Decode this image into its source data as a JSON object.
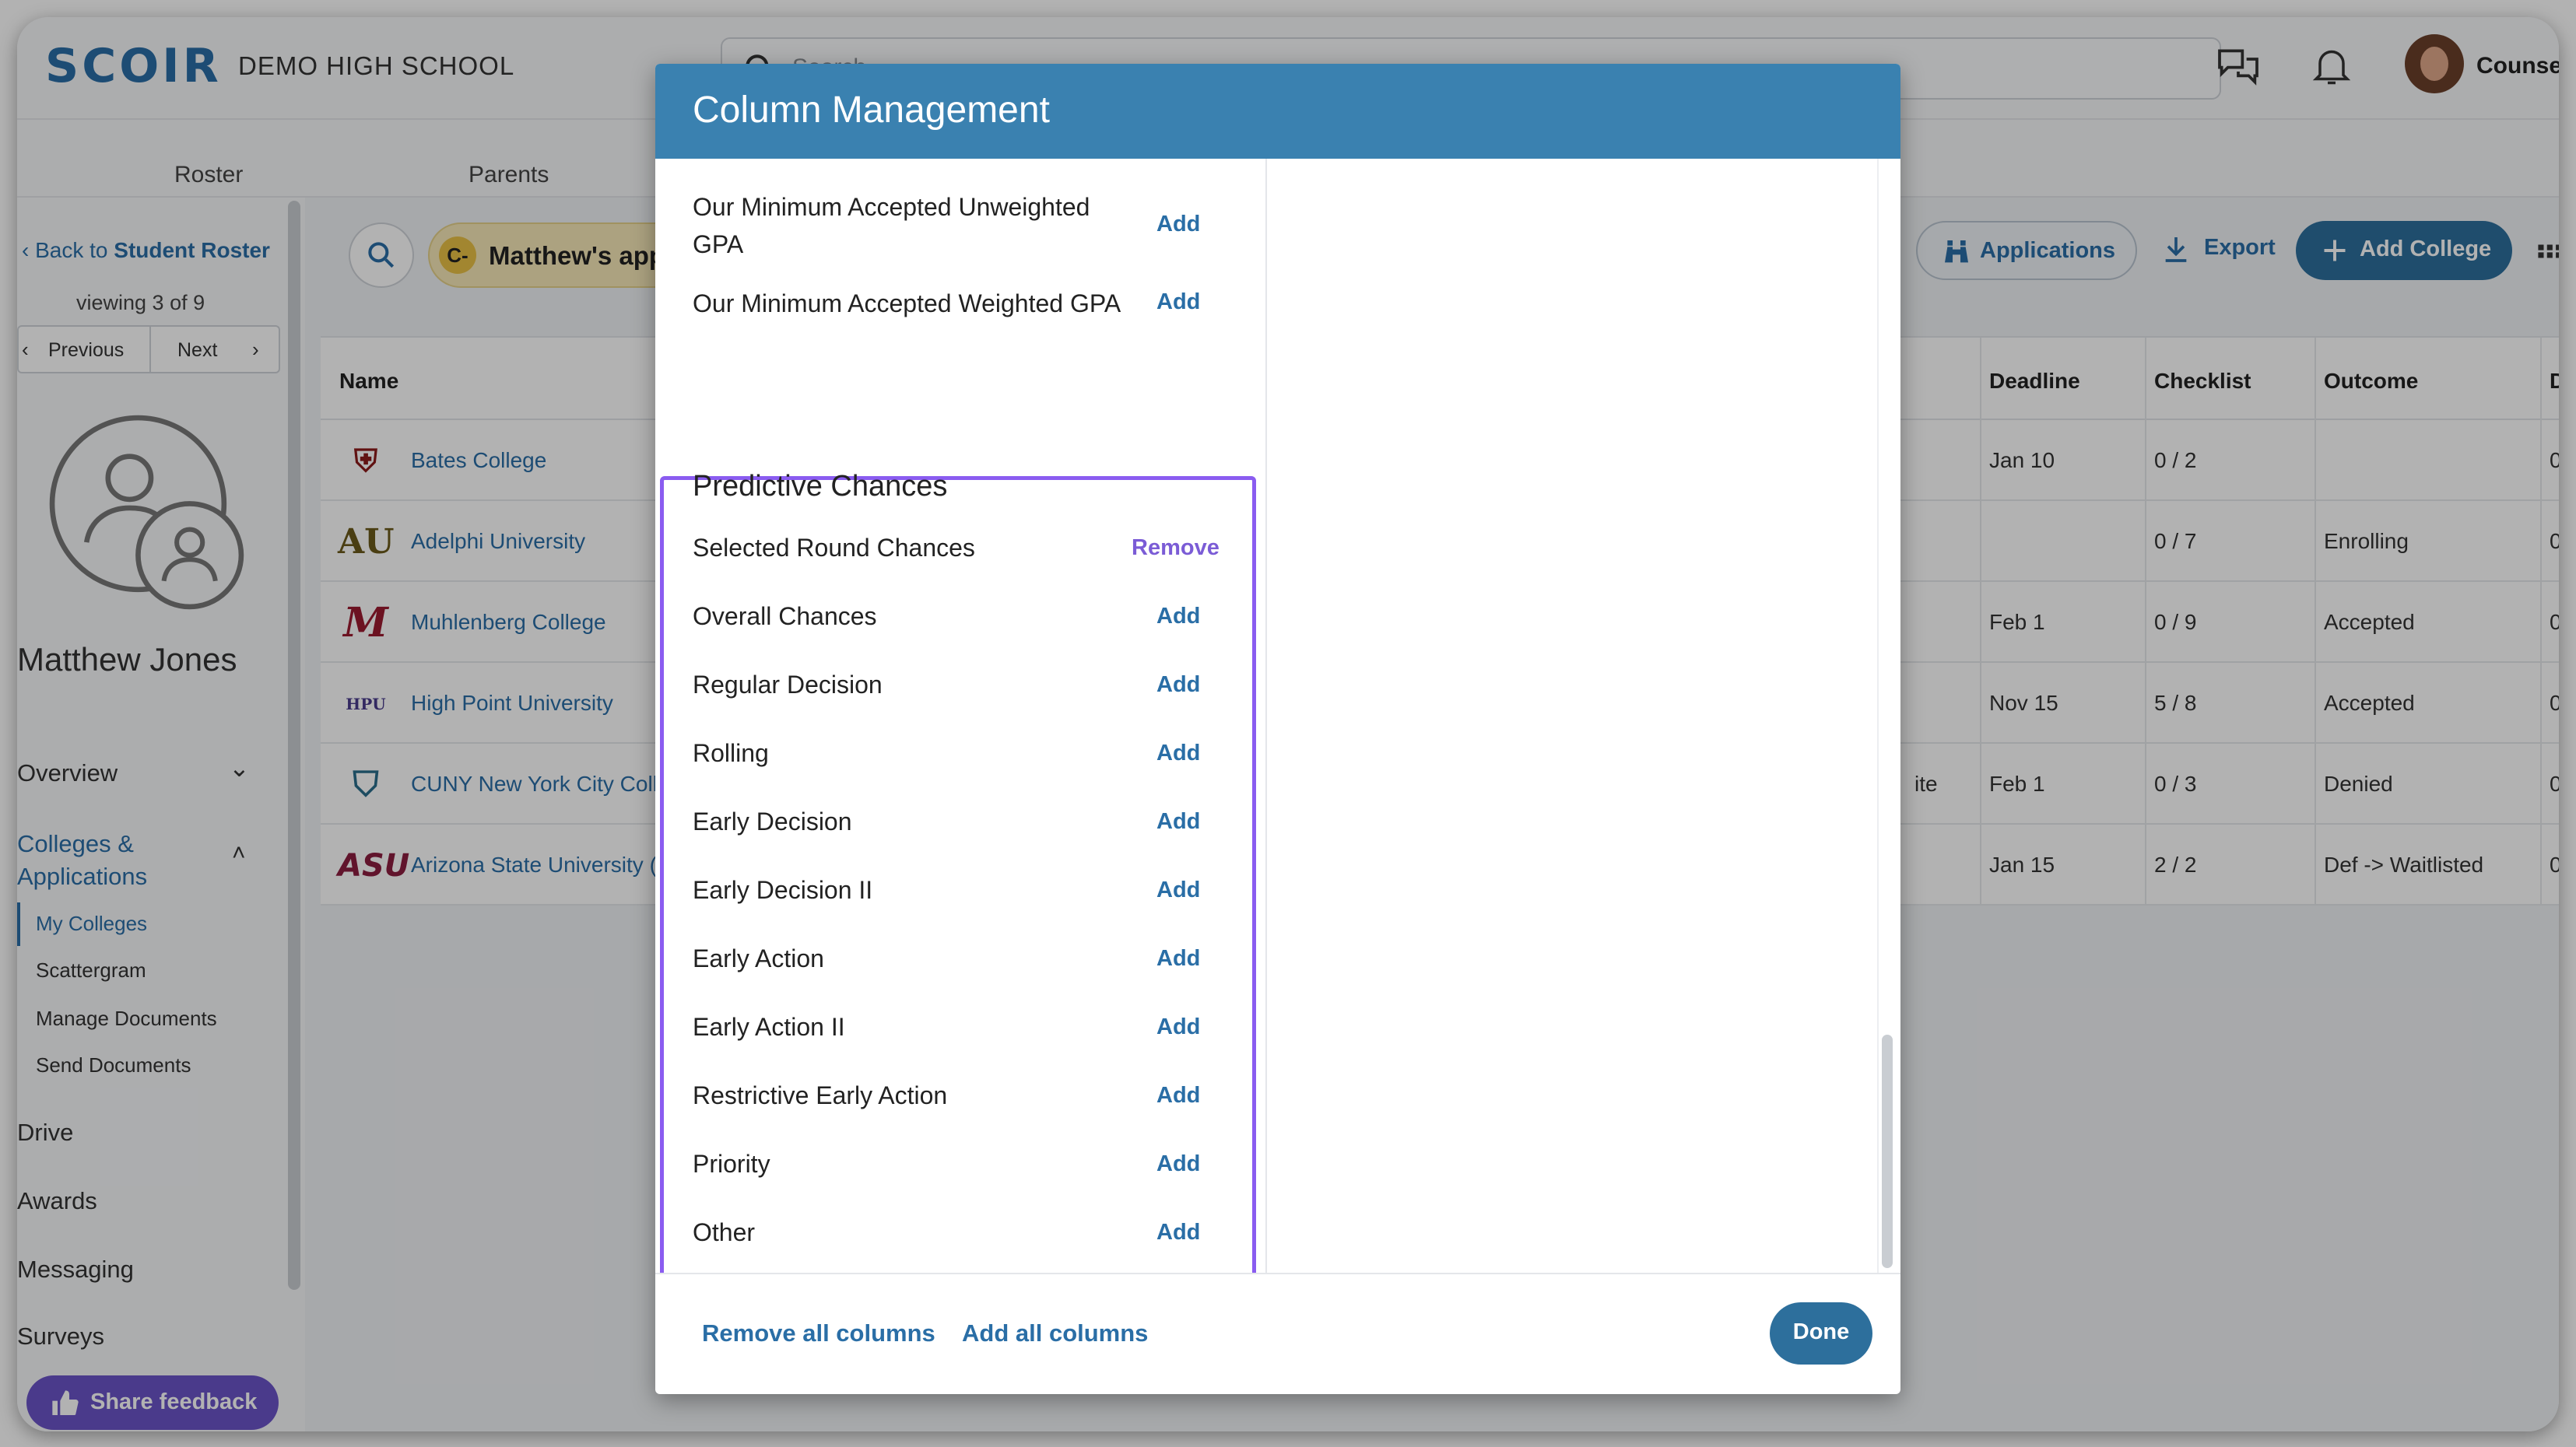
{
  "header": {
    "logo": "SCOIR",
    "school": "DEMO HIGH SCHOOL",
    "search_placeholder": "Search",
    "user": "Counsel"
  },
  "subnav": [
    "Roster",
    "Parents"
  ],
  "sidebar": {
    "back_prefix": "Back to ",
    "back_bold": "Student Roster",
    "viewing": "viewing 3 of 9",
    "previous": "Previous",
    "next": "Next",
    "student_name": "Matthew Jones",
    "items": [
      {
        "label": "Overview"
      },
      {
        "label": "Colleges & Applications"
      },
      {
        "label": "Drive"
      },
      {
        "label": "Awards"
      },
      {
        "label": "Messaging"
      },
      {
        "label": "Surveys"
      }
    ],
    "subitems": [
      "My Colleges",
      "Scattergram",
      "Manage Documents",
      "Send Documents"
    ],
    "feedback": "Share feedback"
  },
  "toolbar": {
    "list_badge": "C-",
    "list_name": "Matthew's app li",
    "applications": "Applications",
    "export": "Export",
    "add_college": "Add College"
  },
  "table": {
    "headers": [
      "Name",
      "Deadline",
      "Checklist",
      "Outcome",
      "Do"
    ],
    "rows": [
      {
        "name": "Bates College",
        "extra": "",
        "deadline": "Jan 10",
        "checklist": "0 / 2",
        "outcome": "",
        "do": "0",
        "logo": "bobcat"
      },
      {
        "name": "Adelphi University",
        "extra": "",
        "deadline": "",
        "checklist": "0 / 7",
        "outcome": "Enrolling",
        "do": "0",
        "logo": "AU"
      },
      {
        "name": "Muhlenberg College",
        "extra": "",
        "deadline": "Feb 1",
        "checklist": "0 / 9",
        "outcome": "Accepted",
        "do": "0",
        "logo": "M"
      },
      {
        "name": "High Point University",
        "extra": "",
        "deadline": "Nov 15",
        "checklist": "5 / 8",
        "outcome": "Accepted",
        "do": "0",
        "logo": "HPU"
      },
      {
        "name": "CUNY New York City Colle",
        "extra": "ite",
        "deadline": "Feb 1",
        "checklist": "0 / 3",
        "outcome": "Denied",
        "do": "0",
        "logo": "shield"
      },
      {
        "name": "Arizona State University (T",
        "extra": "",
        "deadline": "Jan 15",
        "checklist": "2 / 2",
        "outcome": "Def -> Waitlisted",
        "do": "0",
        "logo": "ASU"
      }
    ]
  },
  "modal": {
    "title": "Column Management",
    "top_rows": [
      {
        "label": "Our Minimum Accepted Unweighted",
        "label2": "GPA",
        "action": "Add"
      },
      {
        "label": "Our Minimum Accepted Weighted GPA",
        "action": "Add"
      }
    ],
    "section_title": "Predictive Chances",
    "section_rows": [
      {
        "label": "Selected Round Chances",
        "action": "Remove"
      },
      {
        "label": "Overall Chances",
        "action": "Add"
      },
      {
        "label": "Regular Decision",
        "action": "Add"
      },
      {
        "label": "Rolling",
        "action": "Add"
      },
      {
        "label": "Early Decision",
        "action": "Add"
      },
      {
        "label": "Early Decision II",
        "action": "Add"
      },
      {
        "label": "Early Action",
        "action": "Add"
      },
      {
        "label": "Early Action II",
        "action": "Add"
      },
      {
        "label": "Restrictive Early Action",
        "action": "Add"
      },
      {
        "label": "Priority",
        "action": "Add"
      },
      {
        "label": "Other",
        "action": "Add"
      }
    ],
    "remove_all": "Remove all columns",
    "add_all": "Add all columns",
    "done": "Done"
  },
  "colors": {
    "brand": "#2a6ea6",
    "header": "#3a81b0",
    "highlight": "#8a5cf0",
    "feedback": "#6b54c8"
  }
}
